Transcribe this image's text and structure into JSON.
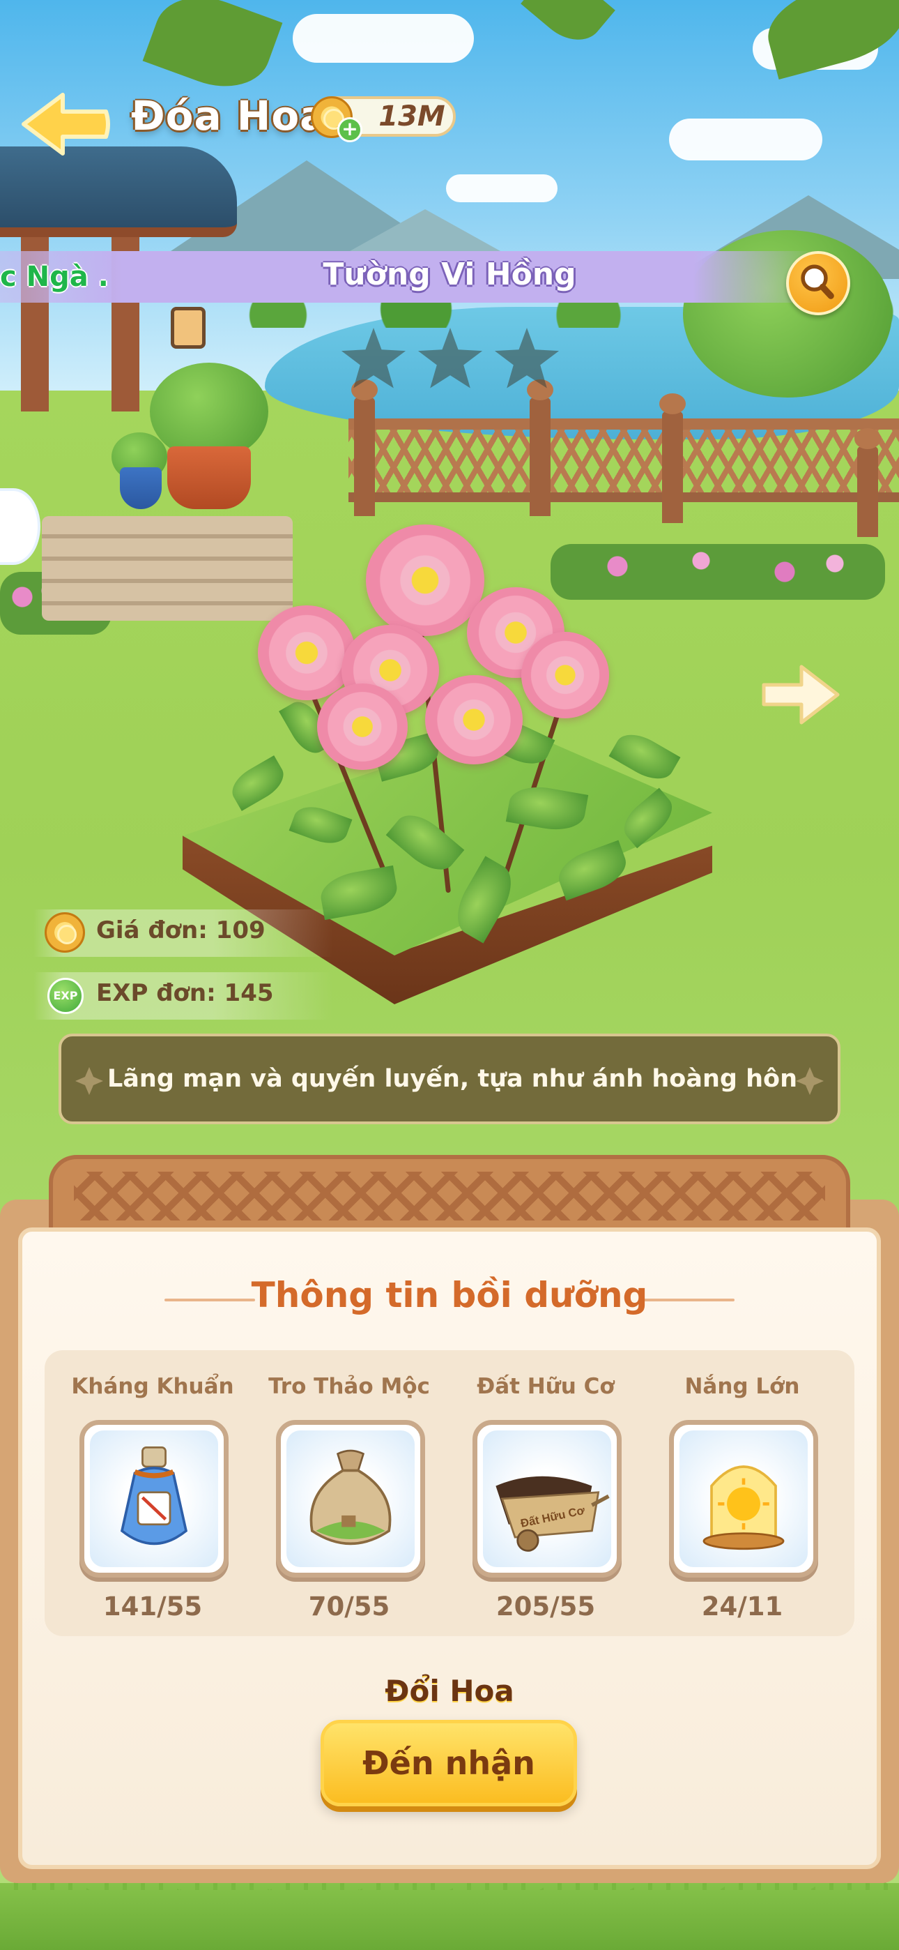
{
  "header": {
    "title": "Đóa Hoa",
    "currency_amount": "13M"
  },
  "banner": {
    "left_partial": "c Ngà .",
    "flower_name": "Tường Vi Hồng",
    "stars_filled": 0,
    "stars_total": 3
  },
  "stats": {
    "price_label": "Giá đơn: 109",
    "exp_label": "EXP đơn: 145",
    "exp_icon_text": "EXP"
  },
  "description": "Lãng mạn và quyến luyến, tựa như ánh hoàng hôn",
  "panel": {
    "title": "Thông tin bồi dưỡng",
    "items": [
      {
        "name": "Kháng Khuẩn",
        "count": "141/55",
        "icon": "antibacterial-bottle-icon"
      },
      {
        "name": "Tro Thảo Mộc",
        "count": "70/55",
        "icon": "herb-ash-sack-icon"
      },
      {
        "name": "Đất Hữu Cơ",
        "count": "205/55",
        "icon": "organic-soil-cart-icon"
      },
      {
        "name": "Nắng Lớn",
        "count": "24/11",
        "icon": "sun-jar-icon"
      }
    ],
    "cart_text": "Đất Hữu Cơ",
    "section_label": "Đổi Hoa",
    "button_label": "Đến nhận"
  },
  "colors": {
    "accent": "#d46a2a",
    "button": "#fbbd21",
    "banner": "#c2b0ef"
  }
}
